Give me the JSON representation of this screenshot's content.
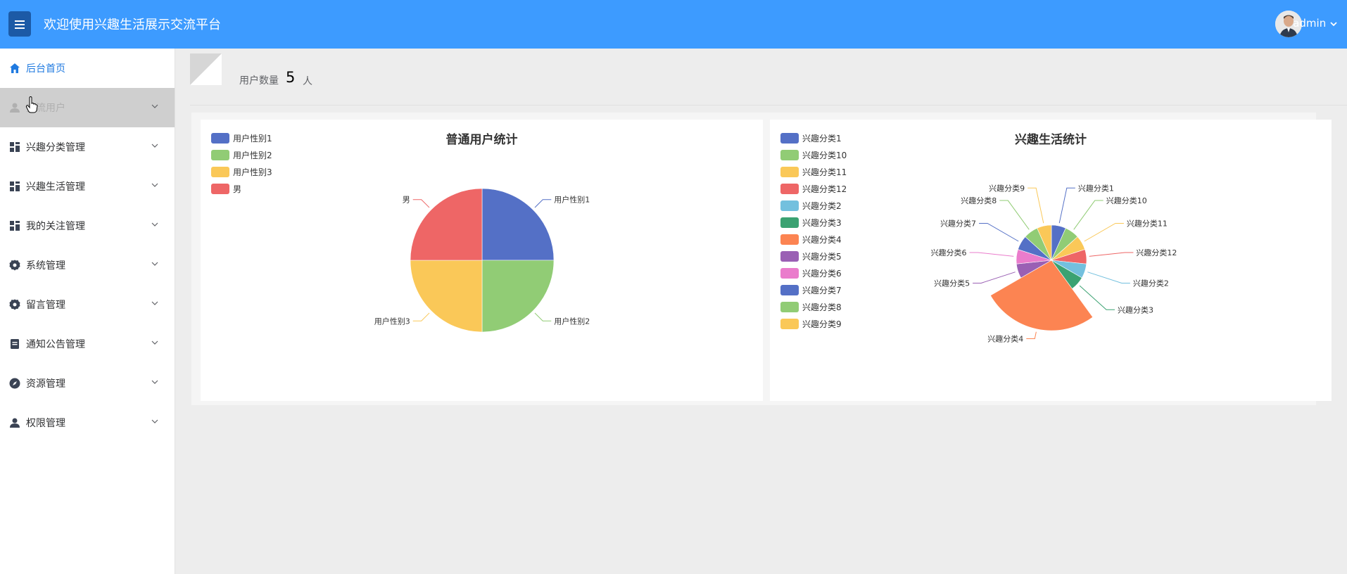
{
  "header": {
    "title": "欢迎使用兴趣生活展示交流平台",
    "user": "admin"
  },
  "sidebar": {
    "items": [
      {
        "label": "后台首页",
        "icon": "home-icon"
      },
      {
        "label": "交流用户",
        "icon": "user-icon"
      },
      {
        "label": "兴趣分类管理",
        "icon": "grid-icon"
      },
      {
        "label": "兴趣生活管理",
        "icon": "grid-icon"
      },
      {
        "label": "我的关注管理",
        "icon": "grid-icon"
      },
      {
        "label": "系统管理",
        "icon": "gear-icon"
      },
      {
        "label": "留言管理",
        "icon": "gear-icon"
      },
      {
        "label": "通知公告管理",
        "icon": "document-icon"
      },
      {
        "label": "资源管理",
        "icon": "compass-icon"
      },
      {
        "label": "权限管理",
        "icon": "user-icon"
      }
    ]
  },
  "stats": {
    "label": "用户数量",
    "count": "5",
    "unit": "人"
  },
  "colors": {
    "header": "#3d9bff",
    "palette": [
      "#5470c6",
      "#91cc75",
      "#fac858",
      "#ee6666",
      "#73c0de",
      "#3ba272",
      "#fc8452",
      "#9a60b4",
      "#ea7ccc"
    ]
  },
  "chart_data": [
    {
      "type": "pie",
      "title": "普通用户统计",
      "legend_position": "top-left",
      "categories": [
        "用户性别1",
        "用户性别2",
        "用户性别3",
        "男"
      ],
      "values": [
        1,
        1,
        1,
        1
      ]
    },
    {
      "type": "pie",
      "variant": "rose",
      "title": "兴趣生活统计",
      "legend_position": "top-left",
      "categories": [
        "兴趣分类1",
        "兴趣分类10",
        "兴趣分类11",
        "兴趣分类12",
        "兴趣分类2",
        "兴趣分类3",
        "兴趣分类4",
        "兴趣分类5",
        "兴趣分类6",
        "兴趣分类7",
        "兴趣分类8",
        "兴趣分类9"
      ],
      "values": [
        1,
        1,
        1,
        1,
        1,
        1,
        4,
        1,
        1,
        1,
        1,
        1
      ]
    }
  ]
}
